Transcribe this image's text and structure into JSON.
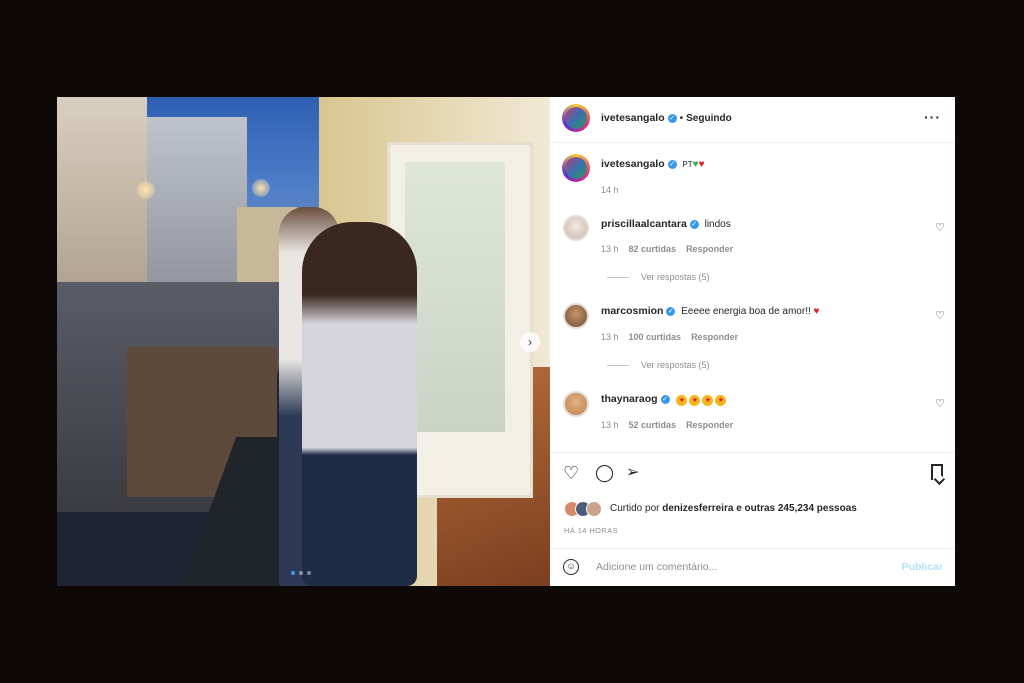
{
  "post": {
    "author": "ivetesangalo",
    "following_label": "Seguindo",
    "caption_user": "ivetesangalo",
    "caption_text": "PT",
    "caption_emojis": [
      "green-heart",
      "red-heart"
    ],
    "caption_time": "14 h"
  },
  "comments": [
    {
      "user": "priscillaalcantara",
      "text": "lindos",
      "time": "13 h",
      "likes": "82 curtidas",
      "reply_label": "Responder",
      "view_replies": "Ver respostas (5)"
    },
    {
      "user": "marcosmion",
      "text": "Eeeee energia boa de amor!!",
      "time": "13 h",
      "likes": "100 curtidas",
      "reply_label": "Responder",
      "view_replies": "Ver respostas (5)"
    },
    {
      "user": "thaynaraog",
      "text": "",
      "emojis": [
        "star-struck-face",
        "star-struck-face",
        "star-struck-face",
        "star-struck-face"
      ],
      "time": "13 h",
      "likes": "52 curtidas",
      "reply_label": "Responder"
    }
  ],
  "likes": {
    "prefix": "Curtido por",
    "user": "denizesferreira",
    "suffix": "e outras 245,234 pessoas"
  },
  "time_ago": "HÁ 14 HORAS",
  "comment_box": {
    "placeholder": "Adicione um comentário...",
    "publish_label": "Publicar"
  },
  "carousel": {
    "total": 3,
    "active": 1
  },
  "colors": {
    "background": "#0e0806",
    "verified": "#3897f0",
    "publish_disabled": "#b2dffc",
    "text_secondary": "#8e8e8e"
  }
}
